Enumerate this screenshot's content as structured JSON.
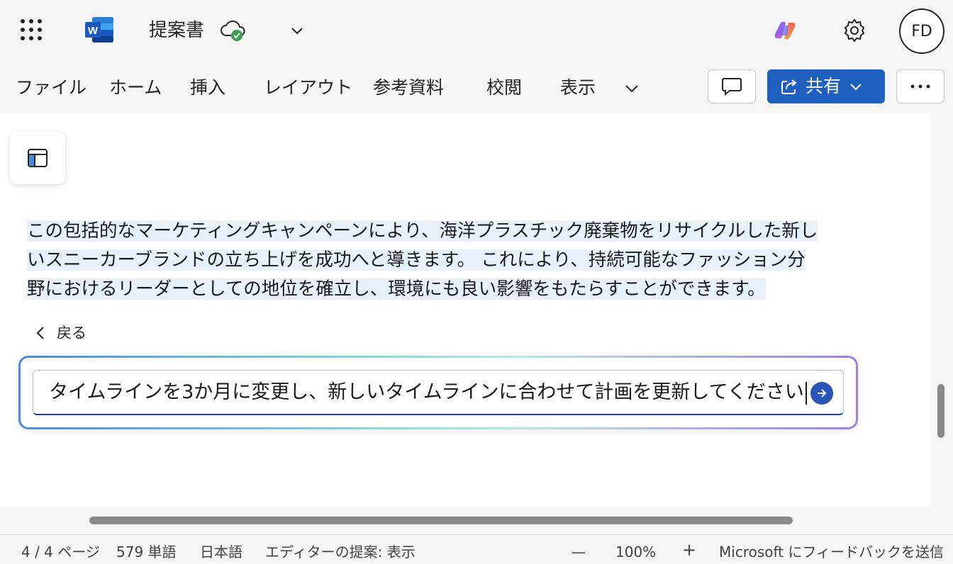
{
  "titlebar": {
    "app_icon": "word-icon",
    "app_letter": "W",
    "doc_title": "提案書",
    "sync_status_icon": "cloud-check-icon",
    "avatar_initials": "FD"
  },
  "ribbon": {
    "tabs": [
      "ファイル",
      "ホーム",
      "挿入",
      "レイアウト",
      "参考資料",
      "校閲",
      "表示"
    ],
    "share_label": "共有"
  },
  "document": {
    "lines": [
      "この包括的なマーケティングキャンペーンにより、海洋プラスチック廃棄物をリサイクルした新し",
      "いスニーカーブランドの立ち上げを成功へと導きます。 これにより、持続可能なファッション分",
      "野におけるリーダーとしての地位を確立し、環境にも良い影響をもたらすことができます。"
    ]
  },
  "copilot": {
    "back_label": "戻る",
    "prompt_value": "タイムラインを3か月に変更し、新しいタイムラインに合わせて計画を更新してください"
  },
  "status": {
    "page": "4 / 4 ページ",
    "words": "579 単語",
    "language": "日本語",
    "editor": "エディターの提案: 表示",
    "zoom_minus": "—",
    "zoom": "100%",
    "zoom_plus": "+",
    "feedback": "Microsoft にフィードバックを送信"
  },
  "colors": {
    "accent": "#1f5fbf",
    "highlight": "#e8f0fc",
    "send": "#2a55b8"
  }
}
